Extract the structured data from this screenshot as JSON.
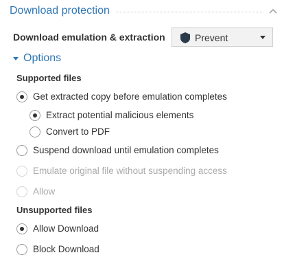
{
  "section": {
    "title": "Download protection"
  },
  "emulation": {
    "label": "Download emulation & extraction",
    "selected": "Prevent"
  },
  "options": {
    "label": "Options"
  },
  "supported": {
    "title": "Supported files",
    "opt_extract": "Get extracted copy before emulation completes",
    "sub_malicious": "Extract potential malicious elements",
    "sub_pdf": "Convert to PDF",
    "opt_suspend": "Suspend download until emulation completes",
    "opt_emulate_original": "Emulate original file without suspending access",
    "opt_allow": "Allow"
  },
  "unsupported": {
    "title": "Unsupported files",
    "opt_allow_download": "Allow Download",
    "opt_block_download": "Block Download"
  },
  "colors": {
    "accent": "#2f77b6",
    "shield": "#2b3a4a",
    "disabled_text": "#aaaaaa"
  },
  "icons": {
    "collapse": "chevron-up-icon",
    "dropdown": "caret-down-icon",
    "shield": "shield-icon",
    "options": "triangle-down-icon"
  }
}
